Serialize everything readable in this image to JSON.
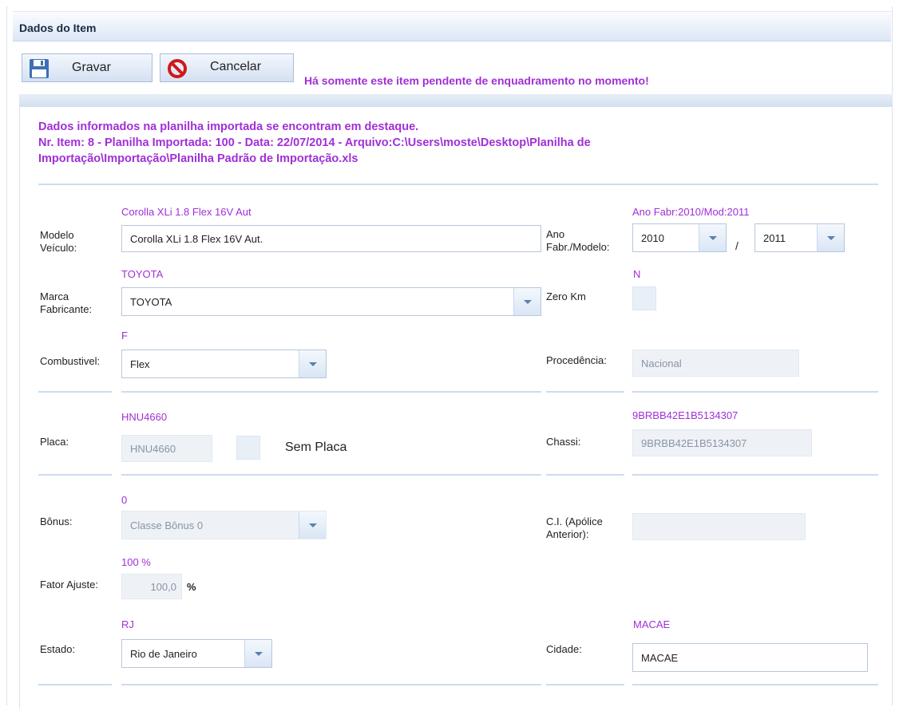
{
  "header": {
    "title": "Dados do Item"
  },
  "toolbar": {
    "save_label": "Gravar",
    "cancel_label": "Cancelar",
    "pending_message": "Há somente este item pendente de enquadramento no momento!"
  },
  "info": {
    "line1": "Dados informados na planilha importada se encontram em destaque.",
    "line2": "Nr. Item: 8 - Planilha Importada: 100 - Data: 22/07/2014 - Arquivo:C:\\Users\\moste\\Desktop\\Planilha de Importação\\Importação\\Planilha Padrão de Importação.xls"
  },
  "form": {
    "modelo": {
      "label": "Modelo Veículo:",
      "hint": "Corolla XLi 1.8 Flex 16V Aut",
      "value": "Corolla XLi 1.8 Flex 16V Aut."
    },
    "ano": {
      "label": "Ano Fabr./Modelo:",
      "hint": "Ano Fabr:2010/Mod:2011",
      "fabr": "2010",
      "separator": "/",
      "mod": "2011"
    },
    "marca": {
      "label": "Marca Fabricante:",
      "hint": "TOYOTA",
      "value": "TOYOTA"
    },
    "zero_km": {
      "label": "Zero Km",
      "hint": "N"
    },
    "combustivel": {
      "label": "Combustivel:",
      "hint": "F",
      "value": "Flex"
    },
    "procedencia": {
      "label": "Procedência:",
      "value": "Nacional"
    },
    "placa": {
      "label": "Placa:",
      "hint": "HNU4660",
      "value": "HNU4660",
      "sem_placa_label": "Sem Placa"
    },
    "chassi": {
      "label": "Chassi:",
      "hint": "9BRBB42E1B5134307",
      "value": "9BRBB42E1B5134307"
    },
    "bonus": {
      "label": "Bônus:",
      "hint": "0",
      "value": "Classe Bônus 0"
    },
    "ci": {
      "label": "C.I. (Apólice Anterior):",
      "value": ""
    },
    "fator": {
      "label": "Fator Ajuste:",
      "hint": "100 %",
      "value": "100,0",
      "unit": "%"
    },
    "estado": {
      "label": "Estado:",
      "hint": "RJ",
      "value": "Rio de Janeiro"
    },
    "cidade": {
      "label": "Cidade:",
      "hint": "MACAE",
      "value": "MACAE"
    }
  },
  "icons": {
    "save": "floppy-disk-icon",
    "cancel": "no-entry-icon",
    "dropdown": "chevron-down-icon"
  },
  "colors": {
    "highlight": "#a12fd6",
    "accent": "#3d6fb5",
    "cancel_red": "#d01818"
  }
}
